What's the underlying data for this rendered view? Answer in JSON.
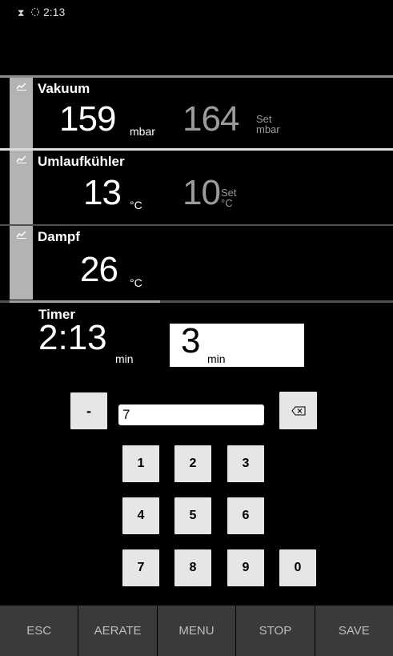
{
  "status": {
    "time": "2:13",
    "hourglass_icon": "hourglass-icon",
    "spinner_icon": "loading-spinner-icon"
  },
  "vacuum": {
    "title": "Vakuum",
    "value": "159",
    "unit": "mbar",
    "set_value": "164",
    "set_label": "Set",
    "set_unit": "mbar"
  },
  "chiller": {
    "title": "Umlaufkühler",
    "value": "13",
    "unit": "°C",
    "set_value": "10",
    "set_label": "Set",
    "set_unit": "°C"
  },
  "steam": {
    "title": "Dampf",
    "value": "26",
    "unit": "°C"
  },
  "timer": {
    "title": "Timer",
    "value": "2:13",
    "unit": "min",
    "set_value": "3",
    "set_unit": "min"
  },
  "keypad": {
    "minus": "-",
    "input_value": "7",
    "backspace_icon": "backspace-icon",
    "keys": [
      "1",
      "2",
      "3",
      "4",
      "5",
      "6",
      "7",
      "8",
      "9",
      "0"
    ]
  },
  "nav": {
    "esc": "ESC",
    "aerate": "AERATE",
    "menu": "MENU",
    "stop": "STOP",
    "save": "SAVE"
  },
  "colors": {
    "background": "#000000",
    "panel_bar": "#b3b3b3",
    "set_text": "#9b9b9b",
    "nav_bg": "#3a3a3a",
    "key_bg": "#e6e6e6"
  }
}
